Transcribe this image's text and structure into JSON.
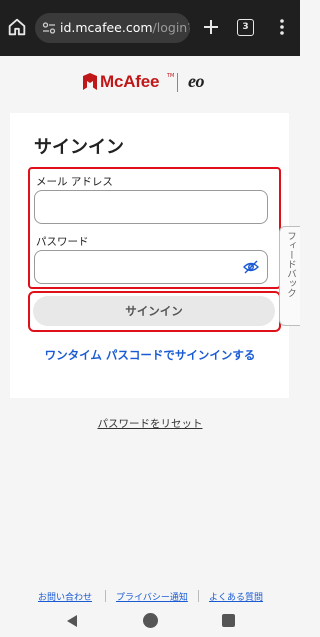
{
  "browser": {
    "url_domain": "id.mcafee.com",
    "url_path": "/login?sta",
    "tab_count": "3",
    "icons": [
      "home-icon",
      "site-settings-icon",
      "plus-icon",
      "kebab-menu-icon"
    ]
  },
  "logo": {
    "brand": "McAfee",
    "tm": "TM",
    "partner": "eo",
    "brand_color": "#c01818"
  },
  "signin": {
    "title": "サインイン",
    "email_label": "メール アドレス",
    "email_value": "",
    "password_label": "パスワード",
    "password_value": "",
    "signin_button": "サインイン",
    "otp_link": "ワンタイム パスコードでサインインする",
    "highlight_color": "#e0101a",
    "link_color": "#1a5bd4"
  },
  "feedback": {
    "label": "フィードバック"
  },
  "reset": {
    "label": "パスワードをリセット"
  },
  "footer": {
    "links": [
      "お問い合わせ",
      "プライバシー通知",
      "よくある質問"
    ]
  },
  "nav": {
    "icons": [
      "back-icon",
      "home-circle-icon",
      "recents-icon"
    ]
  }
}
